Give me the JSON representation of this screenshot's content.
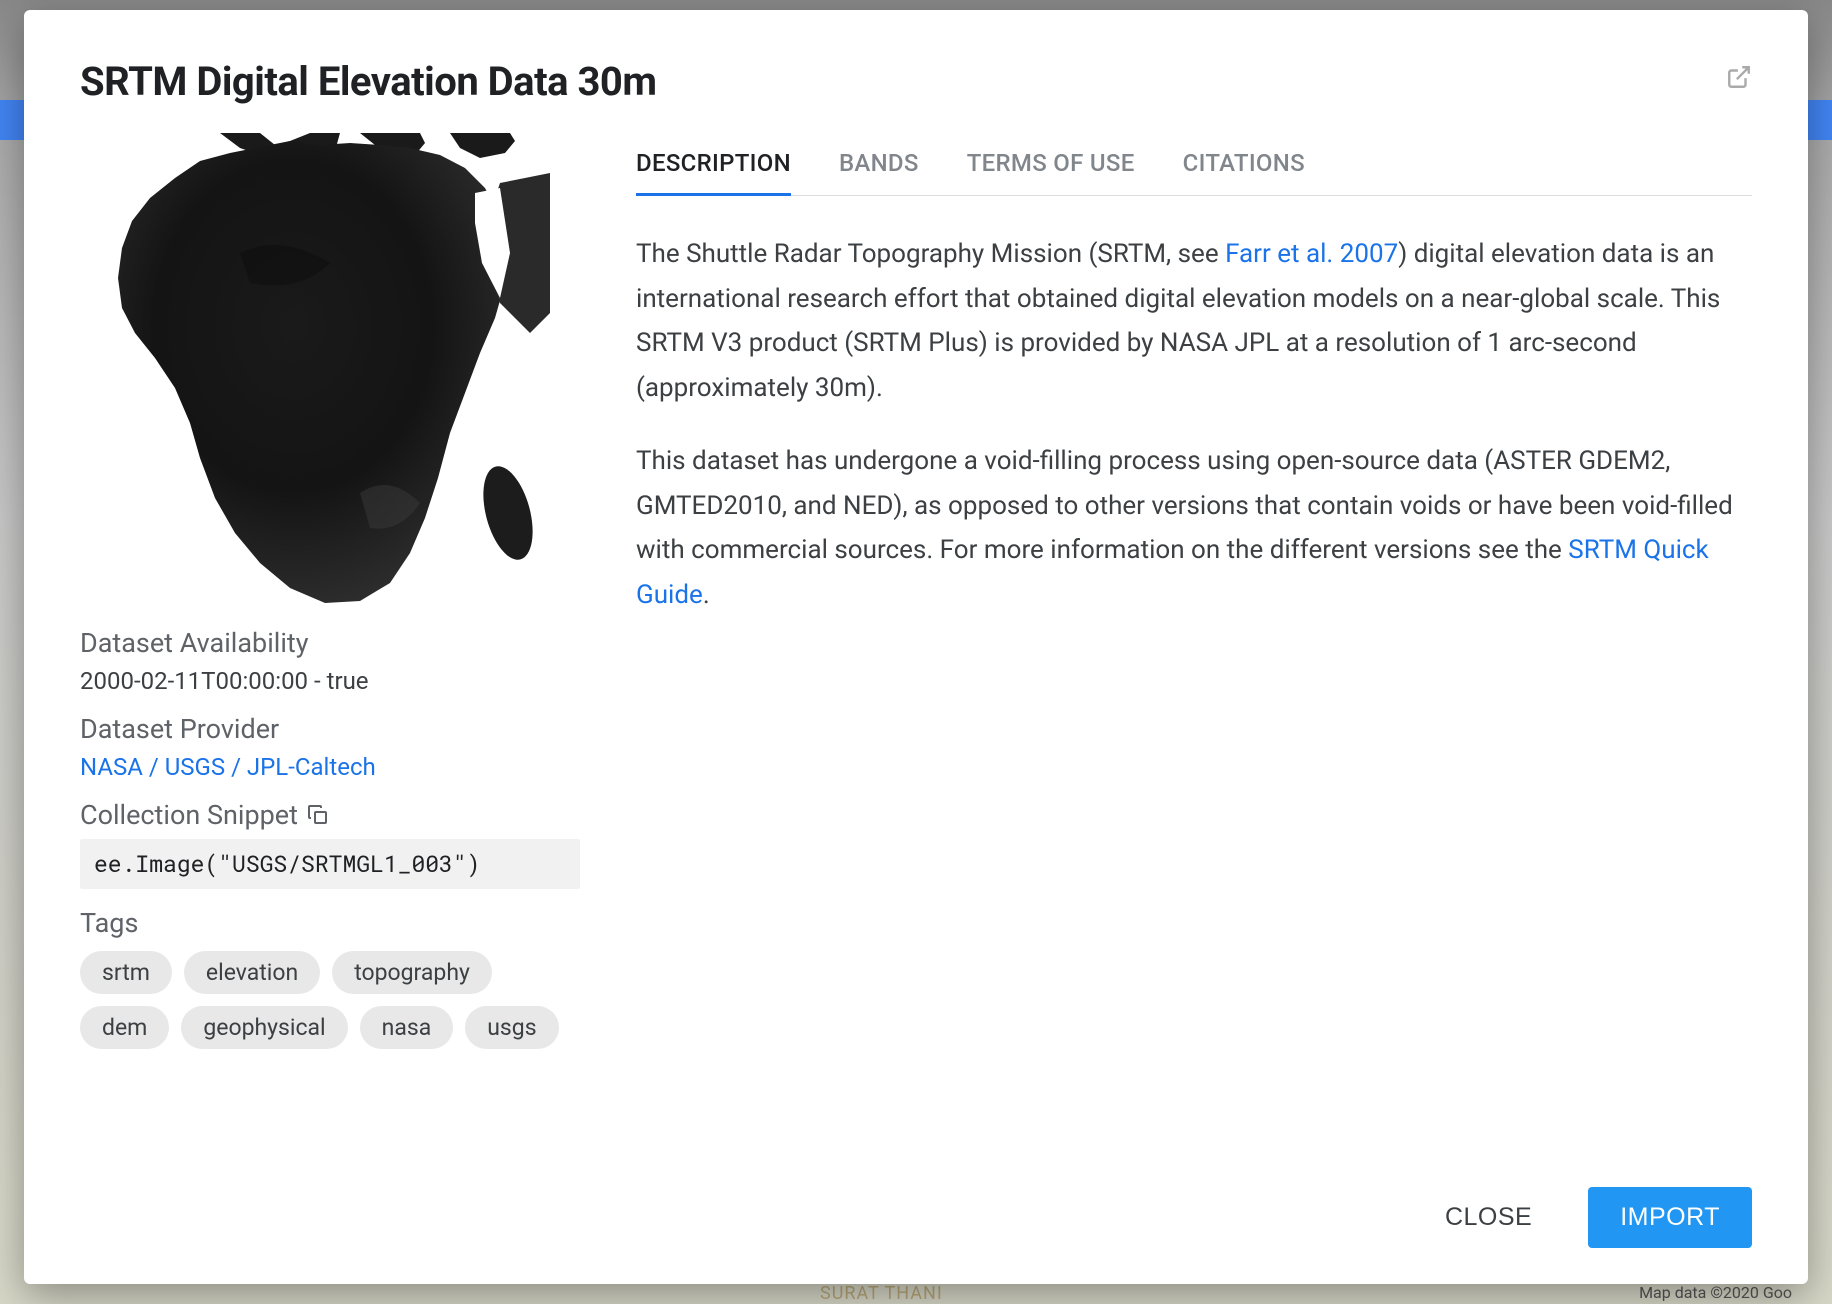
{
  "modal": {
    "title": "SRTM Digital Elevation Data 30m"
  },
  "meta": {
    "availability_label": "Dataset Availability",
    "availability_value": "2000-02-11T00:00:00 - true",
    "provider_label": "Dataset Provider",
    "provider_link": "NASA / USGS / JPL-Caltech",
    "snippet_label": "Collection Snippet",
    "snippet_code": "ee.Image(\"USGS/SRTMGL1_003\")",
    "tags_label": "Tags",
    "tags": [
      "srtm",
      "elevation",
      "topography",
      "dem",
      "geophysical",
      "nasa",
      "usgs"
    ]
  },
  "tabs": {
    "description": "DESCRIPTION",
    "bands": "BANDS",
    "terms": "TERMS OF USE",
    "citations": "CITATIONS"
  },
  "description": {
    "p1_a": "The Shuttle Radar Topography Mission (SRTM, see ",
    "p1_link": "Farr et al. 2007",
    "p1_b": ") digital elevation data is an international research effort that obtained digital elevation models on a near-global scale. This SRTM V3 product (SRTM Plus) is provided by NASA JPL at a resolution of 1 arc-second (approximately 30m).",
    "p2_a": "This dataset has undergone a void-filling process using open-source data (ASTER GDEM2, GMTED2010, and NED), as opposed to other versions that contain voids or have been void-filled with commercial sources. For more information on the different versions see the ",
    "p2_link": "SRTM Quick Guide",
    "p2_b": "."
  },
  "footer": {
    "close": "CLOSE",
    "import": "IMPORT"
  },
  "background": {
    "credit": "Map data ©2020 Goo",
    "label": "SURAT THANI"
  }
}
